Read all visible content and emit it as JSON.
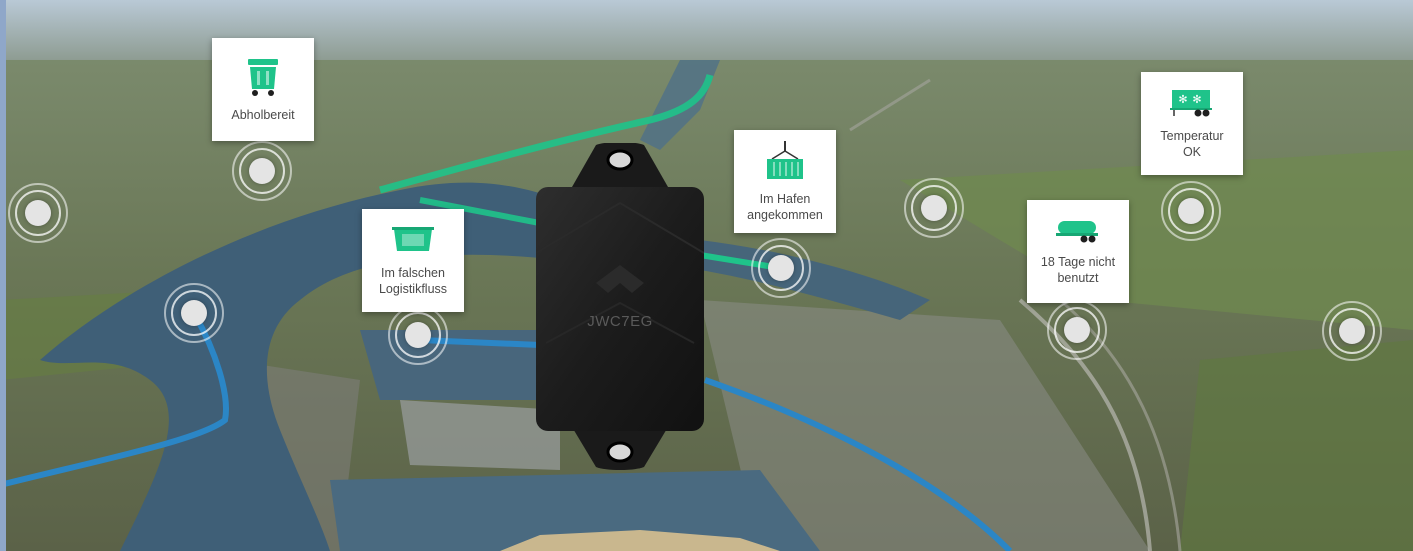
{
  "colors": {
    "accent": "#1fc38a",
    "route_blue": "#2b86c6",
    "card_bg": "#ffffff",
    "text": "#4a4a4a"
  },
  "device": {
    "label": "JWC7EG",
    "icon": "tracker-device"
  },
  "cards": [
    {
      "id": "abholbereit",
      "label": "Abholbereit",
      "icon": "waste-container-icon"
    },
    {
      "id": "falscher-fluss",
      "label": "Im falschen\nLogistikfluss",
      "icon": "skip-container-icon"
    },
    {
      "id": "hafen",
      "label": "Im Hafen\nangekommen",
      "icon": "crane-container-icon"
    },
    {
      "id": "nicht-benutzt",
      "label": "18 Tage nicht\nbenutzt",
      "icon": "tank-trailer-icon"
    },
    {
      "id": "temperatur",
      "label": "Temperatur\nOK",
      "icon": "reefer-trailer-icon"
    }
  ]
}
